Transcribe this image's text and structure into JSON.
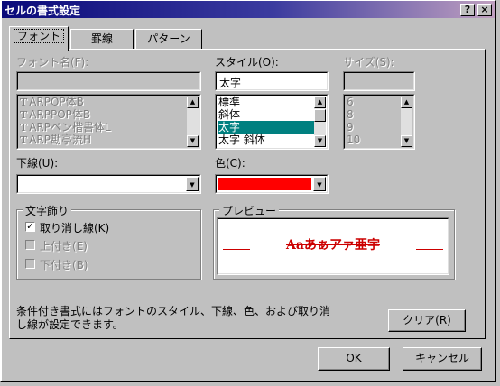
{
  "title": "セルの書式設定",
  "titlebar_buttons": {
    "help": "?",
    "close": "×"
  },
  "tabs": [
    {
      "label": "フォント",
      "active": true
    },
    {
      "label": "罫線",
      "active": false
    },
    {
      "label": "パターン",
      "active": false
    }
  ],
  "font_name": {
    "label": "フォント名(F):",
    "value": "",
    "items": [
      "ARPOP体B",
      "ARPPOP体B",
      "ARPペン楷書体L",
      "ARP勘亭流H"
    ]
  },
  "style": {
    "label": "スタイル(O):",
    "value": "太字",
    "items": [
      "標準",
      "斜体",
      "太字",
      "太字 斜体"
    ],
    "selected_index": 2
  },
  "size": {
    "label": "サイズ(S):",
    "value": "",
    "items": [
      "6",
      "8",
      "9",
      "10"
    ]
  },
  "underline": {
    "label": "下線(U):",
    "value": ""
  },
  "color": {
    "label": "色(C):",
    "value_hex": "#ff0000"
  },
  "effects": {
    "caption": "文字飾り",
    "strikethrough": {
      "label": "取り消し線(K)",
      "checked": true
    },
    "superscript": {
      "label": "上付き(E)",
      "checked": false
    },
    "subscript": {
      "label": "下付き(B)",
      "checked": false
    }
  },
  "preview": {
    "caption": "プレビュー",
    "sample": "Aaあぁアァ亜宇",
    "sample_color": "#cc0000"
  },
  "note": {
    "line1": "条件付き書式にはフォントのスタイル、下線、色、および取り消",
    "line2": "し線が設定できます。"
  },
  "buttons": {
    "clear": "クリア(R)",
    "ok": "OK",
    "cancel": "キャンセル"
  }
}
